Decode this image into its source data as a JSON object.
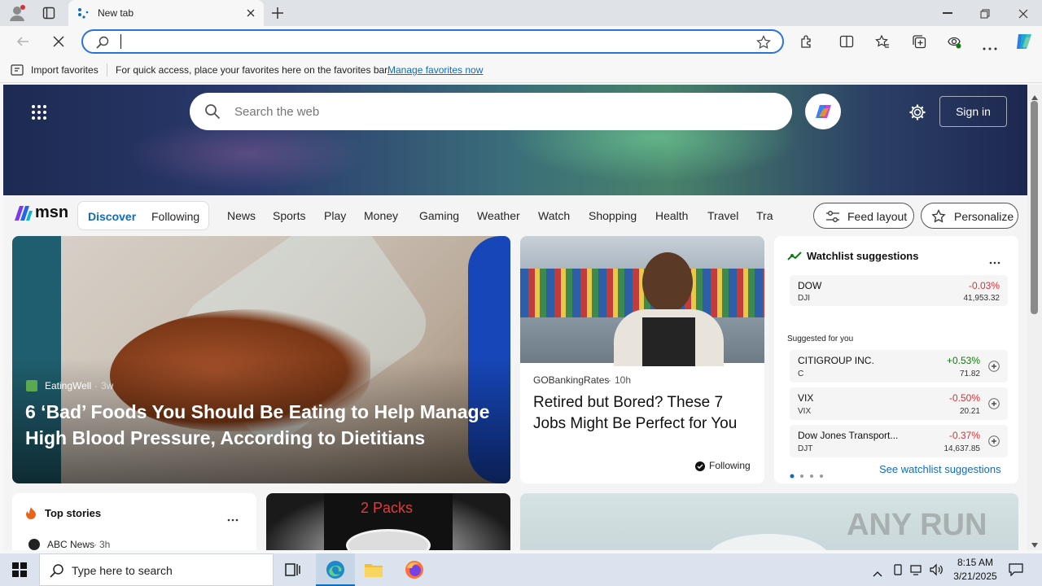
{
  "browser": {
    "tab_title": "New tab",
    "address_value": "",
    "favorites_bar": {
      "import_label": "Import favorites",
      "hint_text": "For quick access, place your favorites here on the favorites bar.",
      "manage_link": "Manage favorites now"
    }
  },
  "msn": {
    "search_placeholder": "Search the web",
    "sign_in": "Sign in",
    "logo_text": "msn",
    "tabs": {
      "discover": "Discover",
      "following": "Following"
    },
    "nav": [
      "News",
      "Sports",
      "Play",
      "Money",
      "Gaming",
      "Weather",
      "Watch",
      "Shopping",
      "Health",
      "Travel",
      "Tra"
    ],
    "feed_layout": "Feed layout",
    "personalize": "Personalize",
    "hero": {
      "source": "EatingWell",
      "age": "3w",
      "headline": "6 ‘Bad’ Foods You Should Be Eating to Help Manage High Blood Pressure, According to Dietitians"
    },
    "story2": {
      "source": "GOBankingRates",
      "age": "10h",
      "headline": "Retired but Bored? These 7 Jobs Might Be Perfect for You",
      "following": "Following"
    },
    "watchlist": {
      "title": "Watchlist suggestions",
      "suggested_label": "Suggested for you",
      "see_more": "See watchlist suggestions",
      "main": {
        "name": "DOW",
        "ticker": "DJI",
        "change": "-0.03%",
        "price": "41,953.32"
      },
      "suggested": [
        {
          "name": "CITIGROUP INC.",
          "ticker": "C",
          "change": "+0.53%",
          "price": "71.82"
        },
        {
          "name": "VIX",
          "ticker": "VIX",
          "change": "-0.50%",
          "price": "20.21"
        },
        {
          "name": "Dow Jones Transport...",
          "ticker": "DJT",
          "change": "-0.37%",
          "price": "14,637.85"
        }
      ]
    },
    "top_stories": {
      "title": "Top stories",
      "first_source": "ABC News",
      "first_age": "3h"
    },
    "promo": {
      "label": "2 Packs"
    }
  },
  "taskbar": {
    "search_placeholder": "Type here to search",
    "time": "8:15 AM",
    "date": "3/21/2025"
  },
  "watermark": "ANY RUN",
  "colors": {
    "accent": "#0f6cbd",
    "negative": "#d13438",
    "positive": "#107c10",
    "address_border": "#2a73d8"
  }
}
